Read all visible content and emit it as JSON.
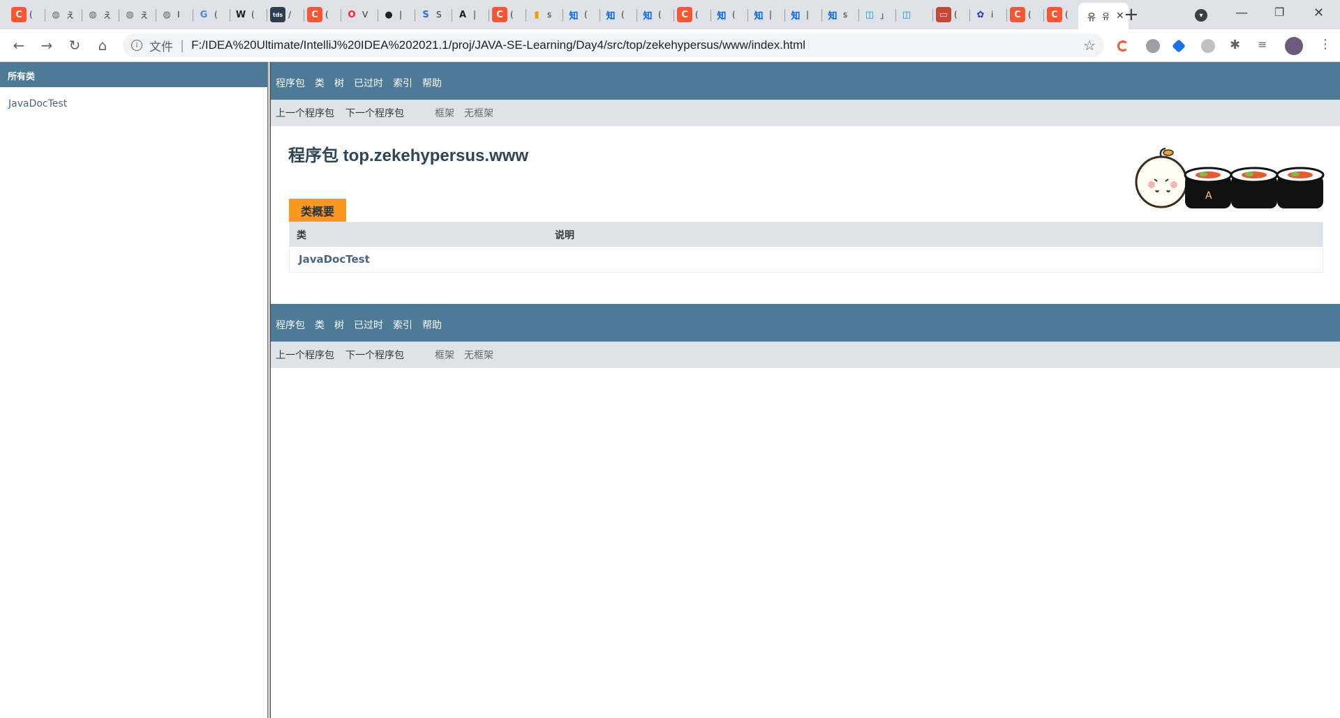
{
  "browser": {
    "tabs": [
      {
        "icon": "csdn-icon",
        "label": "(",
        "color": "#fc5531",
        "glyph": "C"
      },
      {
        "icon": "globe-icon",
        "label": "え",
        "color": "#5f6368",
        "glyph": "◍"
      },
      {
        "icon": "globe-icon",
        "label": "え",
        "color": "#5f6368",
        "glyph": "◍"
      },
      {
        "icon": "globe-icon",
        "label": "え",
        "color": "#5f6368",
        "glyph": "◍"
      },
      {
        "icon": "globe-icon",
        "label": "I",
        "color": "#5f6368",
        "glyph": "◍"
      },
      {
        "icon": "google-icon",
        "label": "(",
        "color": "#4285f4",
        "glyph": "G"
      },
      {
        "icon": "wikipedia-icon",
        "label": "(",
        "color": "#202124",
        "glyph": "W"
      },
      {
        "icon": "tds-icon",
        "label": "/",
        "color": "#2d3e50",
        "glyph": "tds"
      },
      {
        "icon": "csdn-icon",
        "label": "(",
        "color": "#fc5531",
        "glyph": "C"
      },
      {
        "icon": "opera-icon",
        "label": "V",
        "color": "#ff1b2d",
        "glyph": "O"
      },
      {
        "icon": "github-icon",
        "label": "|",
        "color": "#202124",
        "glyph": "●"
      },
      {
        "icon": "sogou-icon",
        "label": "S",
        "color": "#1a73e8",
        "glyph": "S"
      },
      {
        "icon": "bing-translate-icon",
        "label": "|",
        "color": "#202124",
        "glyph": "A"
      },
      {
        "icon": "csdn-icon",
        "label": "(",
        "color": "#fc5531",
        "glyph": "C"
      },
      {
        "icon": "chart-icon",
        "label": "s",
        "color": "#f29900",
        "glyph": "▮"
      },
      {
        "icon": "zhihu-icon",
        "label": "(",
        "color": "#0066ff",
        "glyph": "知"
      },
      {
        "icon": "zhihu-icon",
        "label": "(",
        "color": "#0066ff",
        "glyph": "知"
      },
      {
        "icon": "zhihu-icon",
        "label": "(",
        "color": "#0066ff",
        "glyph": "知"
      },
      {
        "icon": "csdn-icon",
        "label": "(",
        "color": "#fc5531",
        "glyph": "C"
      },
      {
        "icon": "zhihu-icon",
        "label": "(",
        "color": "#0066ff",
        "glyph": "知"
      },
      {
        "icon": "zhihu-icon",
        "label": "|",
        "color": "#0066ff",
        "glyph": "知"
      },
      {
        "icon": "zhihu-icon",
        "label": "|",
        "color": "#0066ff",
        "glyph": "知"
      },
      {
        "icon": "zhihu-icon",
        "label": "s",
        "color": "#0066ff",
        "glyph": "知"
      },
      {
        "icon": "bilibili-icon",
        "label": "」",
        "color": "#00a1d6",
        "glyph": "◫"
      },
      {
        "icon": "bilibili-icon",
        "label": "",
        "color": "#00a1d6",
        "glyph": "◫"
      },
      {
        "icon": "oracle-icon",
        "label": "(",
        "color": "#c74634",
        "glyph": "▭"
      },
      {
        "icon": "baidu-icon",
        "label": "i",
        "color": "#2932e1",
        "glyph": "✿"
      },
      {
        "icon": "csdn-icon",
        "label": "(",
        "color": "#fc5531",
        "glyph": "C"
      },
      {
        "icon": "csdn-icon",
        "label": "(",
        "color": "#fc5531",
        "glyph": "C"
      },
      {
        "icon": "file-icon",
        "label": "유",
        "color": "#5f6368",
        "glyph": "유"
      }
    ],
    "address": {
      "file_label": "文件",
      "url": "F:/IDEA%20Ultimate/IntelliJ%20IDEA%202021.1/proj/JAVA-SE-Learning/Day4/src/top/zekehypersus/www/index.html"
    },
    "colors": {
      "accent": "#4d7a97",
      "orange": "#f8981d"
    }
  },
  "left_frame": {
    "title": "所有类",
    "classes": [
      "JavaDocTest"
    ]
  },
  "nav": {
    "items": [
      "程序包",
      "类",
      "树",
      "已过时",
      "索引",
      "帮助"
    ],
    "prev_package": "上一个程序包",
    "next_package": "下一个程序包",
    "frames": "框架",
    "no_frames": "无框架"
  },
  "content": {
    "package_title": "程序包 top.zekehypersus.www",
    "summary_tab": "类概要",
    "col_class": "类",
    "col_desc": "说明",
    "rows": [
      {
        "name": "JavaDocTest",
        "desc": ""
      }
    ]
  }
}
